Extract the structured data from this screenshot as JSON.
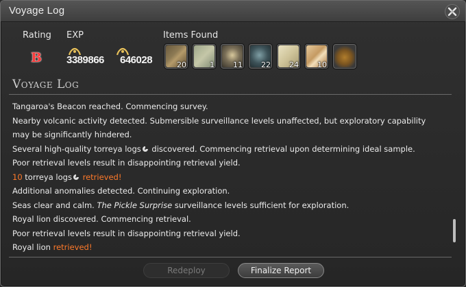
{
  "window": {
    "title": "Voyage Log"
  },
  "header": {
    "rating_label": "Rating",
    "exp_label": "EXP",
    "items_label": "Items Found",
    "rating": "B",
    "exp_values": [
      "3389866",
      "646028"
    ]
  },
  "items": [
    {
      "icon": "torreya-log-icon",
      "count": "20"
    },
    {
      "icon": "map-icon",
      "count": "1"
    },
    {
      "icon": "ore-chunk-icon",
      "count": "11"
    },
    {
      "icon": "crystal-cluster-icon",
      "count": "22"
    },
    {
      "icon": "cloth-bolt-icon",
      "count": "24"
    },
    {
      "icon": "torreya-log-hq-icon",
      "count": "10"
    },
    {
      "icon": "royal-lion-icon",
      "count": ""
    }
  ],
  "log_title": "Voyage Log",
  "log": {
    "l1": "Tangaroa's Beacon reached. Commencing survey.",
    "l2": "Nearby volcanic activity detected. Submersible surveillance levels unaffected, but exploratory capability may be significantly hindered.",
    "l3a": "Several high-quality torreya logs",
    "l3b": " discovered. Commencing retrieval upon determining ideal sample.",
    "l4": "Poor retrieval levels result in disappointing retrieval yield.",
    "l5a": "10",
    "l5b": " torreya logs",
    "l5c": " retrieved!",
    "l6": "Additional anomalies detected. Continuing exploration.",
    "l7a": "Seas clear and calm. ",
    "l7b": "The Pickle Surprise",
    "l7c": " surveillance levels sufficient for exploration.",
    "l8": "Royal lion discovered. Commencing retrieval.",
    "l9": "Poor retrieval levels result in disappointing retrieval yield.",
    "l10a": "Royal lion",
    "l10b": " retrieved!"
  },
  "buttons": {
    "redeploy": "Redeploy",
    "finalize": "Finalize Report"
  },
  "colors": {
    "accent_orange": "#ff7a2a",
    "rating_red": "#ff3b3b"
  }
}
